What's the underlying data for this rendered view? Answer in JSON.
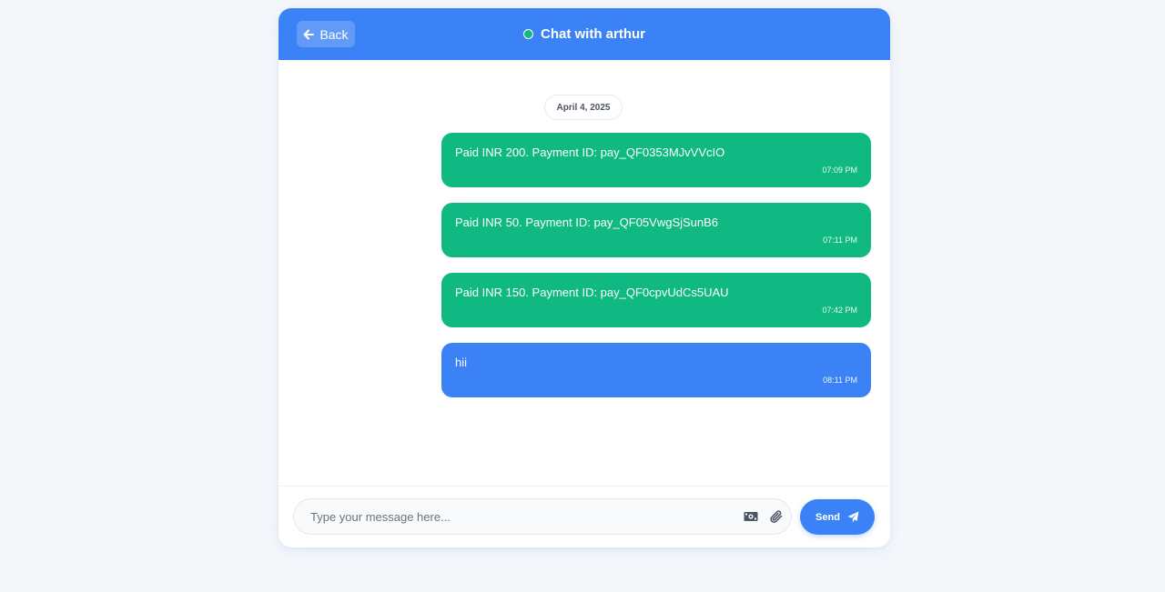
{
  "header": {
    "back_label": "Back",
    "title": "Chat with arthur",
    "status_color": "#10b981",
    "accent": "#3b82f6"
  },
  "conversation": {
    "date": "April 4, 2025",
    "messages": [
      {
        "text": "Paid INR 200. Payment ID: pay_QF0353MJvVVcIO",
        "time": "07:09 PM",
        "kind": "payment",
        "color": "#10b981"
      },
      {
        "text": "Paid INR 50. Payment ID: pay_QF05VwgSjSunB6",
        "time": "07:11 PM",
        "kind": "payment",
        "color": "#10b981"
      },
      {
        "text": "Paid INR 150. Payment ID: pay_QF0cpvUdCs5UAU",
        "time": "07:42 PM",
        "kind": "payment",
        "color": "#10b981"
      },
      {
        "text": "hii",
        "time": "08:11 PM",
        "kind": "text",
        "color": "#3b82f6"
      }
    ]
  },
  "composer": {
    "placeholder": "Type your message here...",
    "value": "",
    "payment_icon": "money-bill-icon",
    "attach_icon": "paperclip-icon",
    "send_label": "Send",
    "send_icon": "paper-plane-icon"
  }
}
